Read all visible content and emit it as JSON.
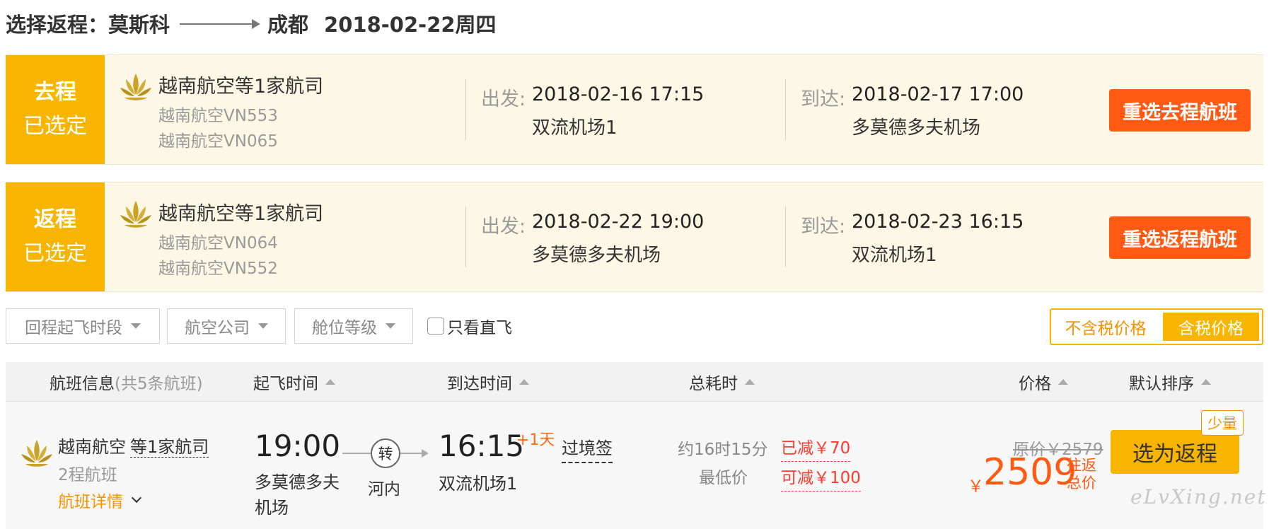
{
  "header": {
    "title_prefix": "选择返程：",
    "from_city": "莫斯科",
    "to_city": "成都",
    "date": "2018-02-22周四"
  },
  "outbound": {
    "tag_line1": "去程",
    "tag_line2": "已选定",
    "airline_main": "越南航空等1家航司",
    "flight_1": "越南航空VN553",
    "flight_2": "越南航空VN065",
    "depart_label": "出发:",
    "depart_time": "2018-02-16 17:15",
    "depart_airport": "双流机场1",
    "arrive_label": "到达:",
    "arrive_time": "2018-02-17 17:00",
    "arrive_airport": "多莫德多夫机场",
    "reselect_label": "重选去程航班"
  },
  "return": {
    "tag_line1": "返程",
    "tag_line2": "已选定",
    "airline_main": "越南航空等1家航司",
    "flight_1": "越南航空VN064",
    "flight_2": "越南航空VN552",
    "depart_label": "出发:",
    "depart_time": "2018-02-22 19:00",
    "depart_airport": "多莫德多夫机场",
    "arrive_label": "到达:",
    "arrive_time": "2018-02-23 16:15",
    "arrive_airport": "双流机场1",
    "reselect_label": "重选返程航班"
  },
  "filters": {
    "time_slot": "回程起飞时段",
    "airline": "航空公司",
    "cabin": "舱位等级",
    "direct_only": "只看直飞",
    "price_excl_tax": "不含税价格",
    "price_incl_tax": "含税价格"
  },
  "list_header": {
    "flight_info": "航班信息",
    "flight_count": "(共5条航班)",
    "depart_time": "起飞时间",
    "arrive_time": "到达时间",
    "duration": "总耗时",
    "price": "价格",
    "sort": "默认排序"
  },
  "flight": {
    "airline": "越南航空",
    "airline_more": "等1家航司",
    "legs": "2程航班",
    "detail_link": "航班详情",
    "depart_time": "19:00",
    "depart_airport": "多莫德多夫机场",
    "transfer_label": "转",
    "transfer_city": "河内",
    "arrive_time": "16:15",
    "plus_day": "+1天",
    "arrive_airport": "双流机场1",
    "visa": "过境签",
    "duration": "约16时15分",
    "lowest": "最低价",
    "discount_1": "已减￥70",
    "discount_2": "可减￥100",
    "original_price": "原价￥2579",
    "currency": "￥",
    "price": "2509",
    "price_note": "往返总价",
    "select_label": "选为返程",
    "few_seats": "少量"
  },
  "watermark": "eLvXing.net",
  "colors": {
    "accent_yellow": "#f7b500",
    "accent_orange": "#ff5a14",
    "card_bg": "#fdf8e6",
    "discount_red": "#ff3b30"
  }
}
